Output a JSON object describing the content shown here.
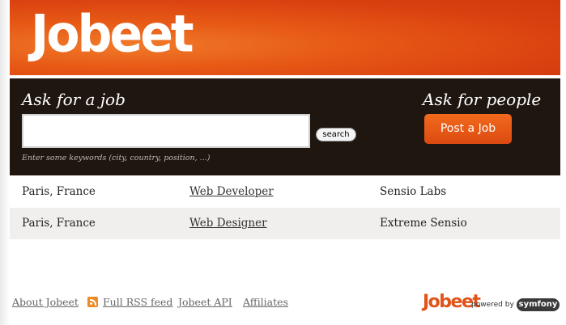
{
  "header": {
    "logo": "Jobeet"
  },
  "search": {
    "ask_job": "Ask for a job",
    "value": "",
    "button_label": "search",
    "help": "Enter some keywords (city, country, position, ...)"
  },
  "people": {
    "ask_people": "Ask for people",
    "post_label": "Post a Job"
  },
  "jobs": [
    {
      "location": "Paris, France",
      "position": "Web Developer",
      "company": "Sensio Labs"
    },
    {
      "location": "Paris, France",
      "position": "Web Designer",
      "company": "Extreme Sensio"
    }
  ],
  "footer": {
    "links": [
      "About Jobeet",
      "Full RSS feed",
      "Jobeet API",
      "Affiliates"
    ],
    "logo": "Jobeet",
    "powered_by": "powered by",
    "symfony": "symfony"
  },
  "colors": {
    "header_orange": "#e75a16",
    "search_bar": "#1f1610",
    "post_button": "#e85a16",
    "alt_row": "#f1efed"
  }
}
